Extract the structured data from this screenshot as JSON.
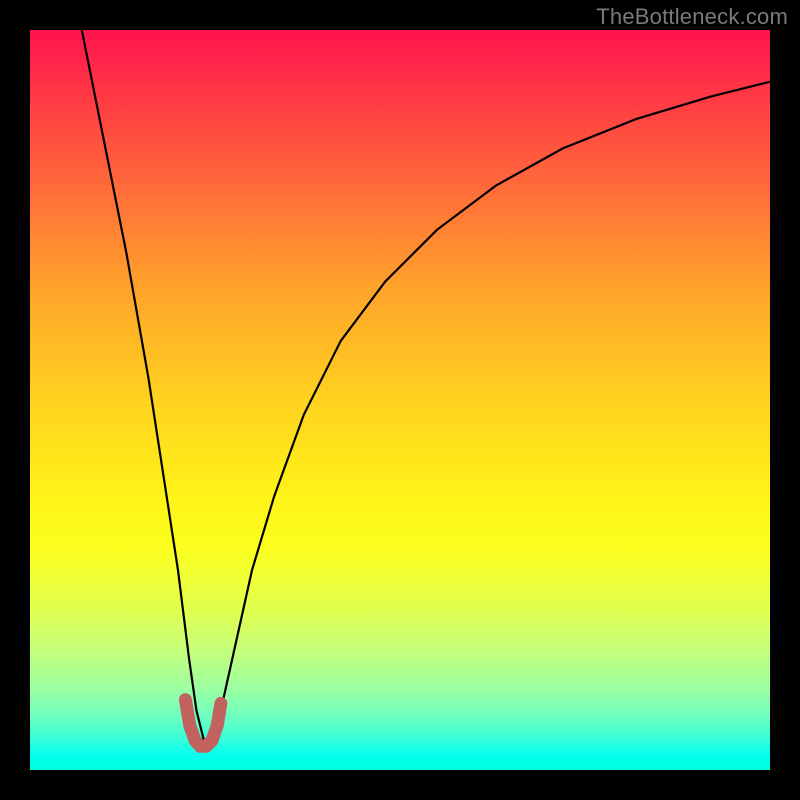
{
  "attribution": "TheBottleneck.com",
  "chart_data": {
    "type": "line",
    "title": "",
    "xlabel": "",
    "ylabel": "",
    "xlim": [
      0,
      100
    ],
    "ylim": [
      0,
      100
    ],
    "grid": false,
    "legend": false,
    "series": [
      {
        "name": "bottleneck-curve",
        "color": "#000000",
        "x": [
          7,
          10,
          13,
          16,
          18,
          20,
          21.5,
          22.5,
          23.5,
          24.5,
          26,
          28,
          30,
          33,
          37,
          42,
          48,
          55,
          63,
          72,
          82,
          92,
          100
        ],
        "y": [
          100,
          85,
          70,
          53,
          40,
          27,
          15,
          8,
          4,
          4,
          9,
          18,
          27,
          37,
          48,
          58,
          66,
          73,
          79,
          84,
          88,
          91,
          93
        ]
      },
      {
        "name": "sweet-spot-marker",
        "color": "#c1625f",
        "x": [
          21.0,
          21.6,
          22.3,
          23.0,
          23.8,
          24.6,
          25.3,
          25.8
        ],
        "y": [
          9.5,
          6.0,
          4.0,
          3.2,
          3.2,
          4.0,
          6.0,
          9.0
        ]
      }
    ]
  }
}
